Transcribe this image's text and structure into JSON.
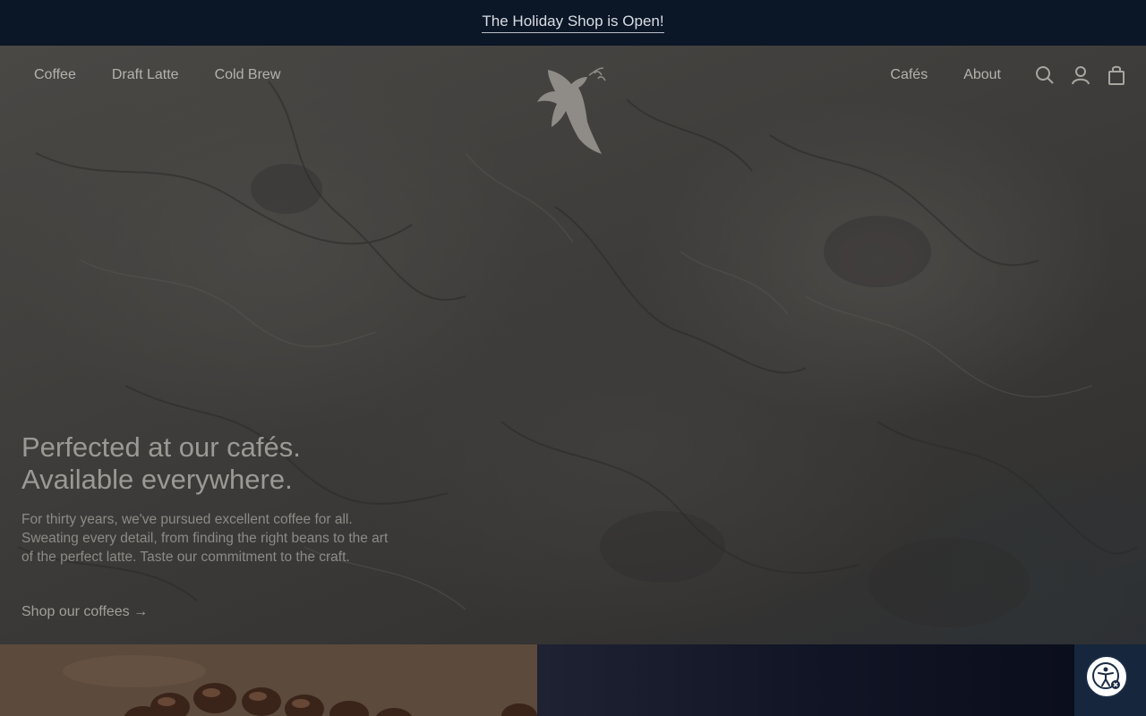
{
  "promo": {
    "text": "The Holiday Shop is Open!"
  },
  "nav": {
    "left": [
      {
        "label": "Coffee"
      },
      {
        "label": "Draft Latte"
      },
      {
        "label": "Cold Brew"
      }
    ],
    "right": [
      {
        "label": "Cafés"
      },
      {
        "label": "About"
      }
    ],
    "icons": [
      "search-icon",
      "account-icon",
      "bag-icon"
    ]
  },
  "hero": {
    "title_line1": "Perfected at our cafés.",
    "title_line2": "Available everywhere.",
    "body": "For thirty years, we've pursued excellent coffee for all. Sweating every detail, from finding the right beans to the art of the perfect latte. Taste our commitment to the craft.",
    "cta": "Shop our coffees →"
  },
  "colors": {
    "promo_bg": "#0b1626",
    "overlay_text": "#9c9995",
    "a11y_ring": "#1b2b44"
  }
}
